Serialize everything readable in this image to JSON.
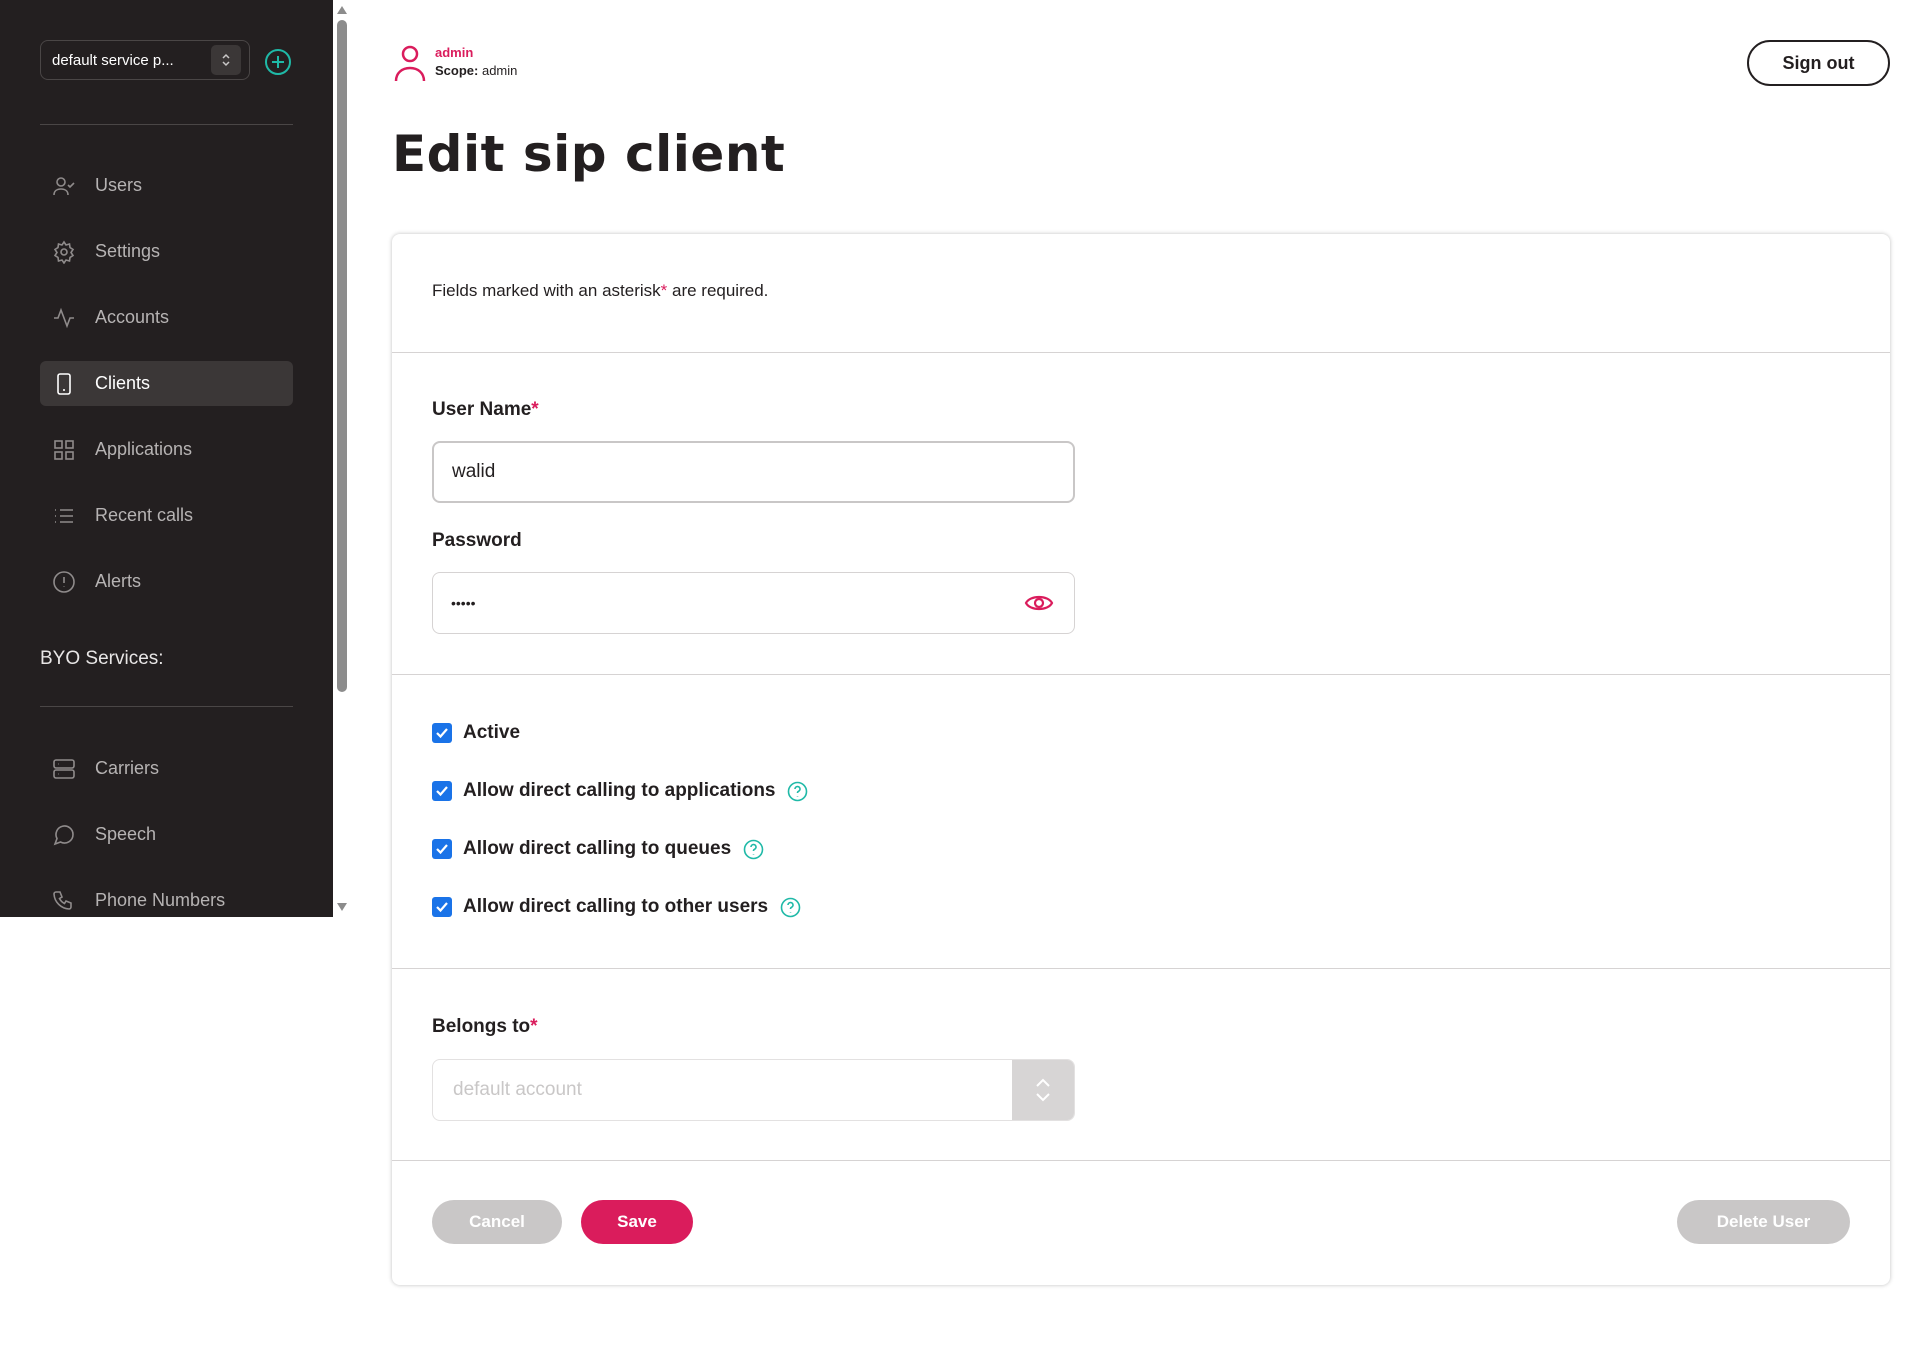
{
  "sidebar": {
    "service_provider": "default service p...",
    "nav": [
      {
        "label": "Users",
        "icon": "users-icon"
      },
      {
        "label": "Settings",
        "icon": "gear-icon"
      },
      {
        "label": "Accounts",
        "icon": "activity-icon"
      },
      {
        "label": "Clients",
        "icon": "smartphone-icon"
      },
      {
        "label": "Applications",
        "icon": "grid-icon"
      },
      {
        "label": "Recent calls",
        "icon": "list-icon"
      },
      {
        "label": "Alerts",
        "icon": "alert-circle-icon"
      }
    ],
    "active_item": "Clients",
    "byo_title": "BYO Services:",
    "byo": [
      {
        "label": "Carriers",
        "icon": "server-icon"
      },
      {
        "label": "Speech",
        "icon": "message-circle-icon"
      },
      {
        "label": "Phone Numbers",
        "icon": "phone-icon"
      }
    ]
  },
  "header": {
    "username": "admin",
    "scope_label": "Scope:",
    "scope_value": "admin",
    "sign_out": "Sign out"
  },
  "page_title": "Edit sip client",
  "form": {
    "required_note_pre": "Fields marked with an asterisk",
    "required_star": "*",
    "required_note_post": " are required.",
    "username_label": "User Name",
    "username_value": "walid",
    "password_label": "Password",
    "password_value": "•••••",
    "checkboxes": [
      {
        "label": "Active",
        "checked": true,
        "help": false
      },
      {
        "label": "Allow direct calling to applications",
        "checked": true,
        "help": true
      },
      {
        "label": "Allow direct calling to queues",
        "checked": true,
        "help": true
      },
      {
        "label": "Allow direct calling to other users",
        "checked": true,
        "help": true
      }
    ],
    "belongs_label": "Belongs to",
    "belongs_value": "default account",
    "cancel": "Cancel",
    "save": "Save",
    "delete": "Delete User"
  },
  "colors": {
    "sidebar_bg": "#231f20",
    "accent": "#da1c5c",
    "teal": "#1fb9a7",
    "checkbox": "#1a73e8",
    "disabled_button": "#c9c7c7"
  }
}
